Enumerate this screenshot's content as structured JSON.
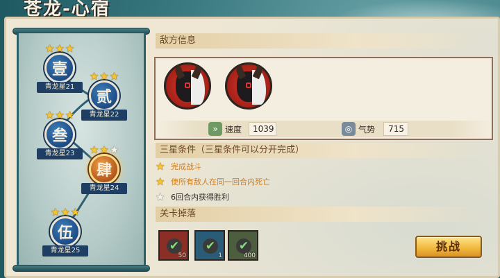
{
  "title": "苍龙-心宿",
  "map": {
    "nodes": [
      {
        "glyph": "壹",
        "label": "青龙星21",
        "stars": 3,
        "active": false
      },
      {
        "glyph": "贰",
        "label": "青龙星22",
        "stars": 3,
        "active": false
      },
      {
        "glyph": "叁",
        "label": "青龙星23",
        "stars": 3,
        "active": false
      },
      {
        "glyph": "肆",
        "label": "青龙星24",
        "stars": 2,
        "active": true
      },
      {
        "glyph": "伍",
        "label": "青龙星25",
        "stars": 3,
        "active": false
      }
    ]
  },
  "enemy_info": {
    "header": "敌方信息",
    "enemies": [
      "oni-portrait",
      "oni-portrait"
    ],
    "speed_label": "速度",
    "speed_value": "1039",
    "momentum_label": "气势",
    "momentum_value": "715"
  },
  "conditions": {
    "header": "三星条件（三星条件可以分开完成）",
    "items": [
      {
        "text": "完成战斗",
        "done": true
      },
      {
        "text": "使所有敌人在同一回合内死亡",
        "done": true
      },
      {
        "text": "6回合内获得胜利",
        "done": false
      }
    ]
  },
  "drops": {
    "header": "关卡掉落",
    "items": [
      {
        "count": "50",
        "color": "#8b2e26"
      },
      {
        "count": "1",
        "color": "#2a5c78"
      },
      {
        "count": "400",
        "color": "#4d5e3e"
      }
    ]
  },
  "challenge_button": "挑战",
  "colors": {
    "star_on": "#f7c531",
    "condition_done": "#d07d1f",
    "button": "#f0b73a"
  }
}
